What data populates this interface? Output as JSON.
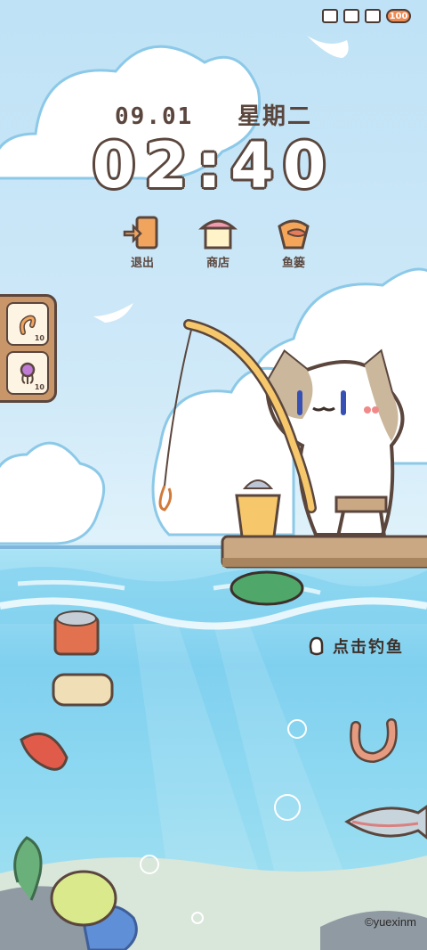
{
  "status": {
    "battery": "100"
  },
  "clock": {
    "date": "09.01",
    "weekday": "星期二",
    "time": "02:40"
  },
  "menu": [
    {
      "label": "退出",
      "icon": "exit-door-icon"
    },
    {
      "label": "商店",
      "icon": "shop-icon"
    },
    {
      "label": "鱼篓",
      "icon": "fish-basket-icon"
    }
  ],
  "bait": [
    {
      "icon": "worm-bait-icon",
      "count": "10"
    },
    {
      "icon": "squid-bait-icon",
      "count": "10"
    }
  ],
  "hint": {
    "label": "点击钓鱼"
  },
  "credit": "©yuexinm",
  "colors": {
    "outline": "#5a463d",
    "sky": "#cfe9f8",
    "water": "#7fd0ef",
    "accent": "#f08a53"
  }
}
